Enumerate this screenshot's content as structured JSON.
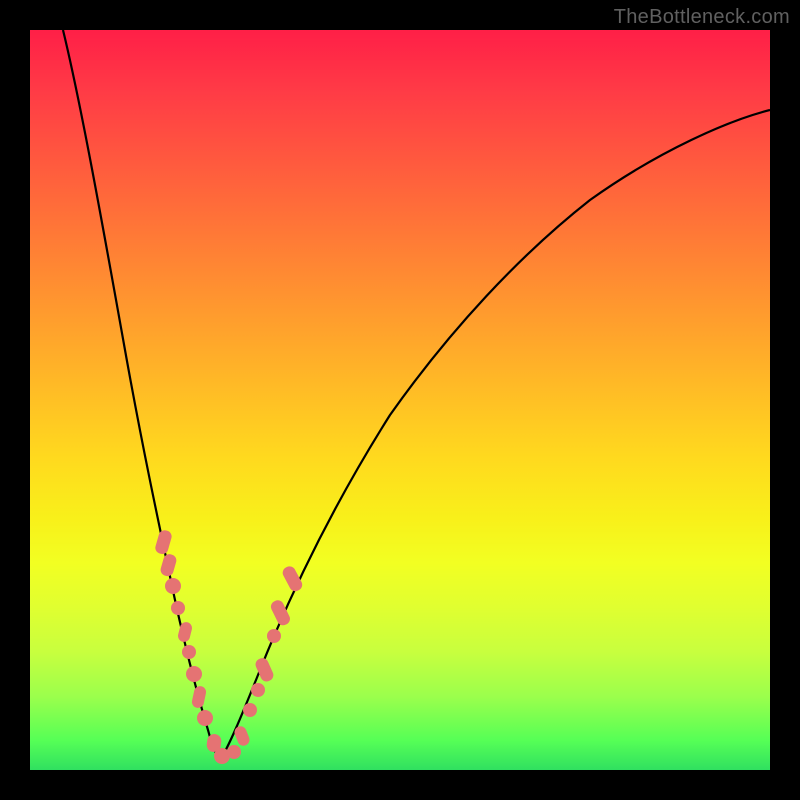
{
  "watermark": "TheBottleneck.com",
  "chart_data": {
    "type": "line",
    "title": "",
    "xlabel": "",
    "ylabel": "",
    "xlim": [
      0,
      100
    ],
    "ylim": [
      0,
      100
    ],
    "grid": false,
    "legend": false,
    "description": "Two parametric black curves over a vertical red→green heat gradient; both curves descend to a common minimum near x≈24 and diverge toward the top-left and upper-right. Pink marker points cluster near the trough.",
    "series": [
      {
        "name": "left-branch",
        "x": [
          4,
          6,
          8,
          10,
          12,
          14,
          16,
          18,
          20,
          22,
          24
        ],
        "values": [
          100,
          88,
          76,
          64,
          53,
          43,
          33,
          24,
          15,
          8,
          2
        ]
      },
      {
        "name": "right-branch",
        "x": [
          24,
          26,
          28,
          30,
          34,
          40,
          48,
          56,
          64,
          72,
          80,
          88,
          96,
          100
        ],
        "values": [
          2,
          7,
          12,
          17,
          26,
          38,
          50,
          59,
          66,
          72,
          77,
          81,
          84,
          86
        ]
      }
    ],
    "markers": [
      {
        "branch": "left",
        "x": 15.5,
        "y": 30
      },
      {
        "branch": "left",
        "x": 16.5,
        "y": 27
      },
      {
        "branch": "left",
        "x": 17.8,
        "y": 23
      },
      {
        "branch": "left",
        "x": 18.8,
        "y": 19
      },
      {
        "branch": "left",
        "x": 19.8,
        "y": 15.5
      },
      {
        "branch": "left",
        "x": 20.6,
        "y": 12
      },
      {
        "branch": "left",
        "x": 21.6,
        "y": 9
      },
      {
        "branch": "left",
        "x": 22.4,
        "y": 6.5
      },
      {
        "branch": "left",
        "x": 23.2,
        "y": 4.3
      },
      {
        "branch": "trough",
        "x": 24.0,
        "y": 2.3
      },
      {
        "branch": "trough",
        "x": 24.8,
        "y": 2.3
      },
      {
        "branch": "trough",
        "x": 25.6,
        "y": 3.5
      },
      {
        "branch": "right",
        "x": 26.6,
        "y": 6.5
      },
      {
        "branch": "right",
        "x": 27.6,
        "y": 9.5
      },
      {
        "branch": "right",
        "x": 28.6,
        "y": 12.5
      },
      {
        "branch": "right",
        "x": 30.0,
        "y": 16.5
      },
      {
        "branch": "right",
        "x": 31.2,
        "y": 20.5
      },
      {
        "branch": "right",
        "x": 32.4,
        "y": 24.0
      },
      {
        "branch": "right",
        "x": 33.6,
        "y": 27.5
      }
    ],
    "colors": {
      "curve": "#000000",
      "marker": "#e57373",
      "gradient_top": "#ff1f47",
      "gradient_mid": "#ffda1e",
      "gradient_bottom": "#30e060"
    }
  }
}
